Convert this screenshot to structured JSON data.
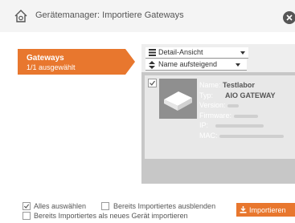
{
  "dialog": {
    "title": "Gerätemanager: Importiere Gateways"
  },
  "sidebar": {
    "tab_title": "Gateways",
    "tab_subtitle": "1/1 ausgewählt"
  },
  "panel": {
    "view_select": "Detail-Ansicht",
    "sort_select": "Name aufsteigend"
  },
  "device": {
    "checked": true,
    "name_label": "Name:",
    "name_value": "Testlabor",
    "type_label": "Typ:",
    "type_value": "AIO GATEWAY",
    "version_label": "Version:",
    "firmware_label": "Firmware:",
    "ip_label": "IP:",
    "mac_label": "MAC:"
  },
  "footer": {
    "select_all": "Alles auswählen",
    "select_all_checked": true,
    "hide_imported": "Bereits Importiertes ausblenden",
    "hide_imported_checked": false,
    "import_as_new": "Bereits Importiertes als neues Gerät importieren",
    "import_as_new_checked": false,
    "import_button": "Importieren"
  },
  "colors": {
    "accent": "#e8772e",
    "panel_bg": "#c7c7c7",
    "card_bg": "#e8e8e8"
  },
  "icons": {
    "title": "house-gear-icon",
    "close": "close-icon",
    "view": "list-icon",
    "sort": "sort-icon",
    "import": "import-icon"
  }
}
